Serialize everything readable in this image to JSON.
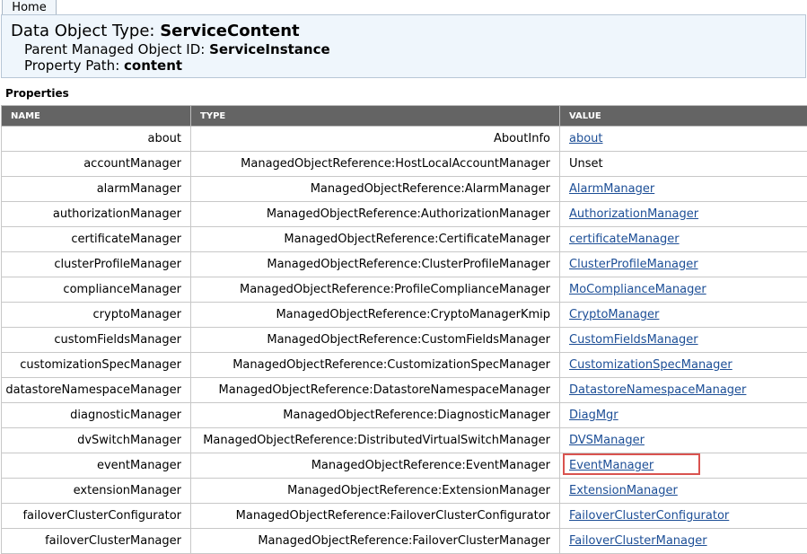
{
  "nav": {
    "home_label": "Home"
  },
  "header": {
    "title_prefix": "Data Object Type: ",
    "title_value": "ServiceContent",
    "parent_label": "Parent Managed Object ID: ",
    "parent_value": "ServiceInstance",
    "path_label": "Property Path: ",
    "path_value": "content"
  },
  "section_title": "Properties",
  "table": {
    "columns": [
      "NAME",
      "TYPE",
      "VALUE"
    ],
    "rows": [
      {
        "name": "about",
        "type": "AboutInfo",
        "value": "about",
        "link": true
      },
      {
        "name": "accountManager",
        "type": "ManagedObjectReference:HostLocalAccountManager",
        "value": "Unset",
        "link": false
      },
      {
        "name": "alarmManager",
        "type": "ManagedObjectReference:AlarmManager",
        "value": "AlarmManager",
        "link": true
      },
      {
        "name": "authorizationManager",
        "type": "ManagedObjectReference:AuthorizationManager",
        "value": "AuthorizationManager",
        "link": true
      },
      {
        "name": "certificateManager",
        "type": "ManagedObjectReference:CertificateManager",
        "value": "certificateManager",
        "link": true
      },
      {
        "name": "clusterProfileManager",
        "type": "ManagedObjectReference:ClusterProfileManager",
        "value": "ClusterProfileManager",
        "link": true
      },
      {
        "name": "complianceManager",
        "type": "ManagedObjectReference:ProfileComplianceManager",
        "value": "MoComplianceManager",
        "link": true
      },
      {
        "name": "cryptoManager",
        "type": "ManagedObjectReference:CryptoManagerKmip",
        "value": "CryptoManager",
        "link": true
      },
      {
        "name": "customFieldsManager",
        "type": "ManagedObjectReference:CustomFieldsManager",
        "value": "CustomFieldsManager",
        "link": true
      },
      {
        "name": "customizationSpecManager",
        "type": "ManagedObjectReference:CustomizationSpecManager",
        "value": "CustomizationSpecManager",
        "link": true
      },
      {
        "name": "datastoreNamespaceManager",
        "type": "ManagedObjectReference:DatastoreNamespaceManager",
        "value": "DatastoreNamespaceManager",
        "link": true
      },
      {
        "name": "diagnosticManager",
        "type": "ManagedObjectReference:DiagnosticManager",
        "value": "DiagMgr",
        "link": true
      },
      {
        "name": "dvSwitchManager",
        "type": "ManagedObjectReference:DistributedVirtualSwitchManager",
        "value": "DVSManager",
        "link": true
      },
      {
        "name": "eventManager",
        "type": "ManagedObjectReference:EventManager",
        "value": "EventManager",
        "link": true
      },
      {
        "name": "extensionManager",
        "type": "ManagedObjectReference:ExtensionManager",
        "value": "ExtensionManager",
        "link": true
      },
      {
        "name": "failoverClusterConfigurator",
        "type": "ManagedObjectReference:FailoverClusterConfigurator",
        "value": "FailoverClusterConfigurator",
        "link": true
      },
      {
        "name": "failoverClusterManager",
        "type": "ManagedObjectReference:FailoverClusterManager",
        "value": "FailoverClusterManager",
        "link": true
      }
    ]
  },
  "colors": {
    "header_bg": "#646464",
    "link": "#1c4e96",
    "highlight": "#d9534f",
    "panel_bg": "#eff6fc"
  }
}
